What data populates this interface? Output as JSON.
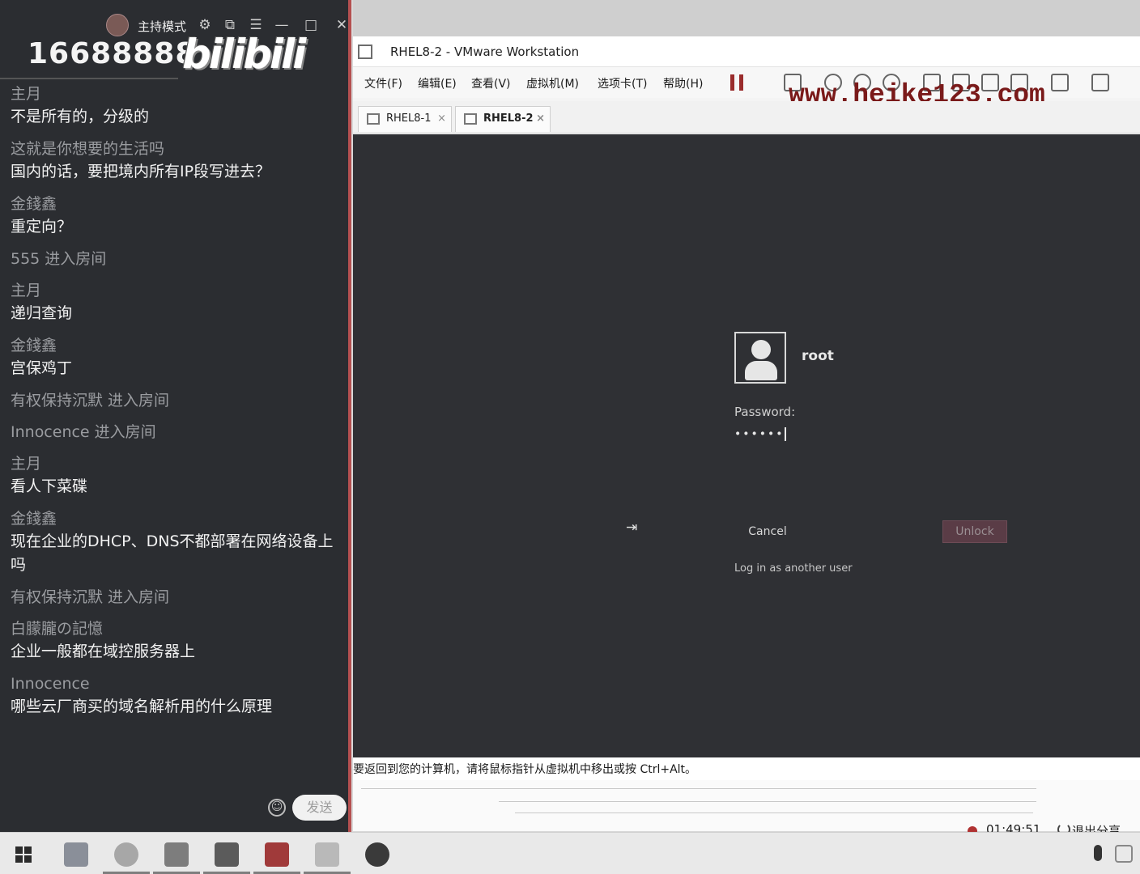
{
  "chat": {
    "host_mode": "主持模式",
    "room_number": "16688888",
    "logo_text": "bilibili",
    "controls": {
      "settings": "⚙",
      "popout": "⧉",
      "menu": "☰",
      "minimize": "—",
      "maximize": "□",
      "close": "✕"
    },
    "messages": [
      {
        "name": "主月",
        "text": "不是所有的，分级的"
      },
      {
        "name": "这就是你想要的生活吗",
        "text": "国内的话，要把境内所有IP段写进去？"
      },
      {
        "name": "金錢鑫",
        "text": "重定向？"
      },
      {
        "name": "555 进入房间",
        "text": ""
      },
      {
        "name": "主月",
        "text": "递归查询"
      },
      {
        "name": "金錢鑫",
        "text": "宫保鸡丁"
      },
      {
        "name": "有权保持沉默 进入房间",
        "text": ""
      },
      {
        "name": "Innocence 进入房间",
        "text": ""
      },
      {
        "name": "主月",
        "text": "看人下菜碟"
      },
      {
        "name": "金錢鑫",
        "text": "现在企业的DHCP、DNS不都部署在网络设备上吗"
      },
      {
        "name": "有权保持沉默 进入房间",
        "text": ""
      },
      {
        "name": "白朦朧の記憶",
        "text": "企业一般都在域控服务器上"
      },
      {
        "name": "Innocence",
        "text": "哪些云厂商买的域名解析用的什么原理"
      }
    ],
    "emoji_icon": "☺",
    "send_label": "发送"
  },
  "vmware": {
    "title": "RHEL8-2 - VMware Workstation",
    "menu": [
      "文件(F)",
      "编辑(E)",
      "查看(V)",
      "虚拟机(M)",
      "选项卡(T)",
      "帮助(H)"
    ],
    "watermark": "www.heike123.com",
    "tabs": [
      {
        "label": "RHEL8-1",
        "close": "×"
      },
      {
        "label": "RHEL8-2",
        "close": "×"
      }
    ],
    "active_tab": "RHEL8-2",
    "lock_screen": {
      "username": "root",
      "password_label": "Password:",
      "password_mask": "••••••",
      "cancel_label": "Cancel",
      "unlock_label": "Unlock",
      "another_user_label": "Log in as another user"
    },
    "hint": "要返回到您的计算机，请将鼠标指针从虚拟机中移出或按 Ctrl+Alt。",
    "recording_time": "01:49:51",
    "exit_share_label": "退出分享"
  },
  "colors": {
    "chat_bg": "#2b2d31",
    "vm_screen_bg": "#2f3034",
    "unlock_bg": "#5a3c46",
    "recording_red": "#b03232",
    "watermark": "#7a1a1a"
  }
}
